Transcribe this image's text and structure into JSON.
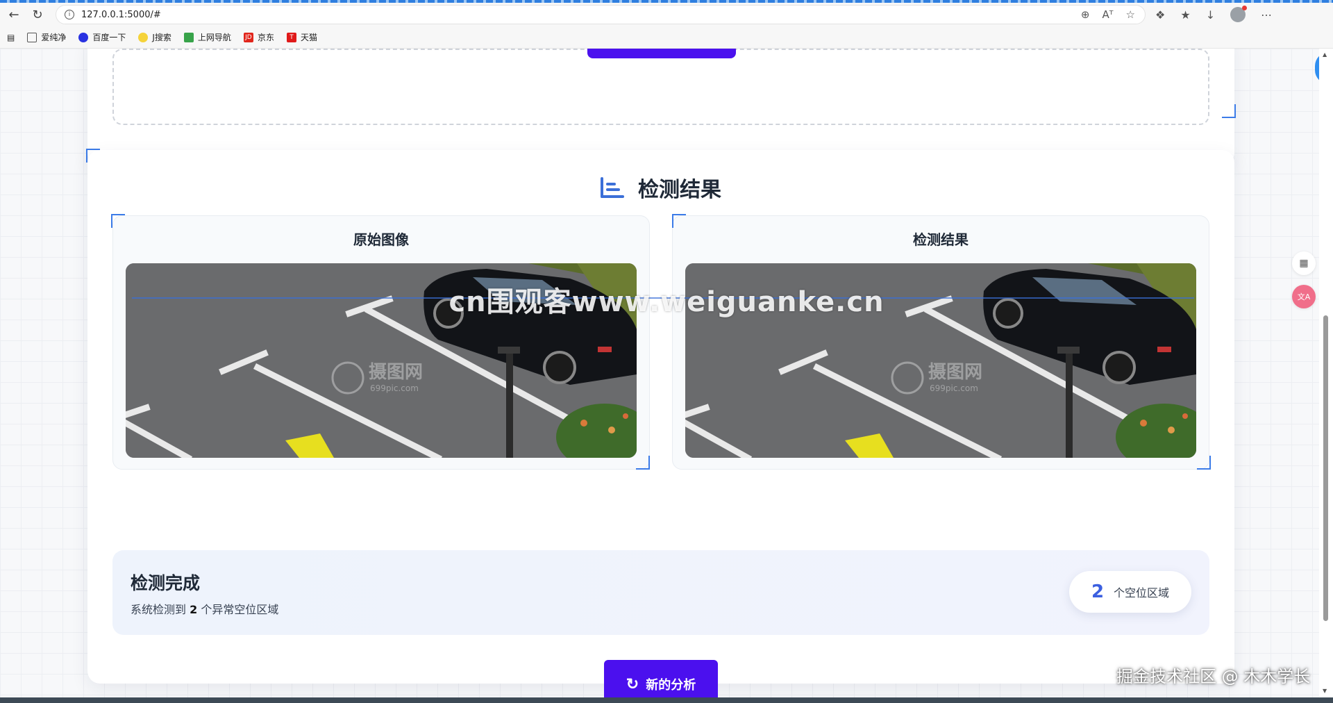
{
  "browser": {
    "url": "127.0.0.1:5000/#",
    "bookmarks": [
      {
        "label": "爱纯净",
        "icon": "folder-icon"
      },
      {
        "label": "百度一下",
        "icon": "baidu-icon"
      },
      {
        "label": "J搜索",
        "icon": "search-logo-icon"
      },
      {
        "label": "上网导航",
        "icon": "navigation-icon"
      },
      {
        "label": "京东",
        "icon": "jd-icon"
      },
      {
        "label": "天猫",
        "icon": "tmall-icon"
      }
    ]
  },
  "results": {
    "title": "检测结果",
    "original_panel": {
      "title": "原始图像"
    },
    "detected_panel": {
      "title": "检测结果"
    },
    "image_watermark": {
      "cn": "摄图网",
      "en": "699pic.com"
    }
  },
  "summary": {
    "title": "检测完成",
    "desc_prefix": "系统检测到 ",
    "count": "2",
    "desc_suffix": " 个异常空位区域",
    "pill_number": "2",
    "pill_label": "个空位区域"
  },
  "actions": {
    "new_analysis": "新的分析"
  },
  "overlays": {
    "watermark": "cn围观客www.weiguanke.cn",
    "credit": "掘金技术社区 @ 木木学长"
  },
  "colors": {
    "accent": "#4b10ee",
    "blue": "#3b6fd8"
  }
}
